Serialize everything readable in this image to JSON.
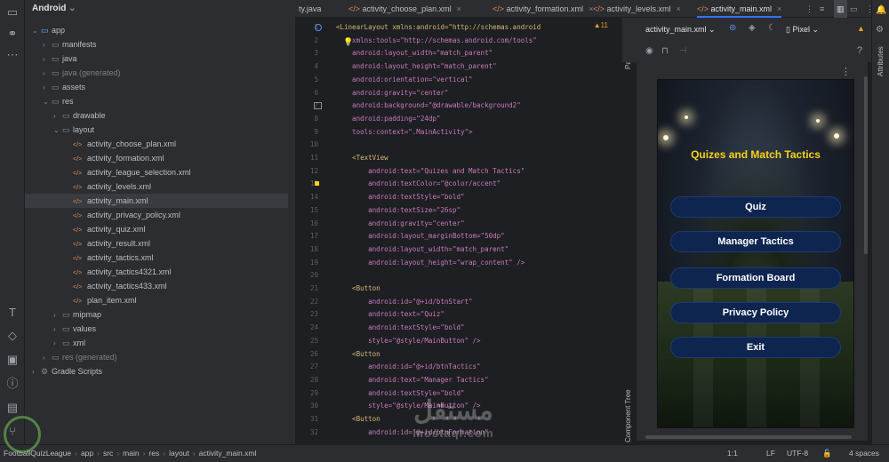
{
  "project": {
    "view_title": "Android",
    "tree": [
      {
        "label": "app",
        "depth": 0,
        "kind": "module",
        "open": true
      },
      {
        "label": "manifests",
        "depth": 1,
        "kind": "folder"
      },
      {
        "label": "java",
        "depth": 1,
        "kind": "folder"
      },
      {
        "label": "java (generated)",
        "depth": 1,
        "kind": "folder",
        "muted": true
      },
      {
        "label": "assets",
        "depth": 1,
        "kind": "folder"
      },
      {
        "label": "res",
        "depth": 1,
        "kind": "folder",
        "open": true
      },
      {
        "label": "drawable",
        "depth": 2,
        "kind": "folder"
      },
      {
        "label": "layout",
        "depth": 2,
        "kind": "folder",
        "open": true
      },
      {
        "label": "activity_choose_plan.xml",
        "depth": 3,
        "kind": "file"
      },
      {
        "label": "activity_formation.xml",
        "depth": 3,
        "kind": "file"
      },
      {
        "label": "activity_league_selection.xml",
        "depth": 3,
        "kind": "file"
      },
      {
        "label": "activity_levels.xml",
        "depth": 3,
        "kind": "file"
      },
      {
        "label": "activity_main.xml",
        "depth": 3,
        "kind": "file",
        "selected": true
      },
      {
        "label": "activity_privacy_policy.xml",
        "depth": 3,
        "kind": "file"
      },
      {
        "label": "activity_quiz.xml",
        "depth": 3,
        "kind": "file"
      },
      {
        "label": "activity_result.xml",
        "depth": 3,
        "kind": "file"
      },
      {
        "label": "activity_tactics.xml",
        "depth": 3,
        "kind": "file"
      },
      {
        "label": "activity_tactics4321.xml",
        "depth": 3,
        "kind": "file"
      },
      {
        "label": "activity_tactics433.xml",
        "depth": 3,
        "kind": "file"
      },
      {
        "label": "plan_item.xml",
        "depth": 3,
        "kind": "file"
      },
      {
        "label": "mipmap",
        "depth": 2,
        "kind": "folder"
      },
      {
        "label": "values",
        "depth": 2,
        "kind": "folder"
      },
      {
        "label": "xml",
        "depth": 2,
        "kind": "folder"
      },
      {
        "label": "res (generated)",
        "depth": 1,
        "kind": "folder",
        "muted": true
      },
      {
        "label": "Gradle Scripts",
        "depth": 0,
        "kind": "gradle"
      }
    ]
  },
  "tabs": [
    {
      "label": "ty.java"
    },
    {
      "label": "activity_choose_plan.xml"
    },
    {
      "label": "activity_formation.xml"
    },
    {
      "label": "activity_levels.xml"
    },
    {
      "label": "activity_main.xml",
      "active": true
    }
  ],
  "editor": {
    "warnings": "▲11",
    "lines": [
      {
        "n": "1",
        "text": "<LinearLayout xmlns:android=\"http://schemas.android"
      },
      {
        "n": "2",
        "text": "    xmlns:tools=\"http://schemas.android.com/tools\""
      },
      {
        "n": "3",
        "text": "    android:layout_width=\"match_parent\""
      },
      {
        "n": "4",
        "text": "    android:layout_height=\"match_parent\""
      },
      {
        "n": "5",
        "text": "    android:orientation=\"vertical\""
      },
      {
        "n": "6",
        "text": "    android:gravity=\"center\""
      },
      {
        "n": "7",
        "text": "    android:background=\"@drawable/background2\""
      },
      {
        "n": "8",
        "text": "    android:padding=\"24dp\""
      },
      {
        "n": "9",
        "text": "    tools:context=\".MainActivity\">"
      },
      {
        "n": "10",
        "text": ""
      },
      {
        "n": "11",
        "text": "    <TextView"
      },
      {
        "n": "12",
        "text": "        android:text=\"Quizes and Match Tactics\""
      },
      {
        "n": "13",
        "text": "        android:textColor=\"@color/accent\""
      },
      {
        "n": "14",
        "text": "        android:textStyle=\"bold\""
      },
      {
        "n": "15",
        "text": "        android:textSize=\"26sp\""
      },
      {
        "n": "16",
        "text": "        android:gravity=\"center\""
      },
      {
        "n": "17",
        "text": "        android:layout_marginBottom=\"50dp\""
      },
      {
        "n": "18",
        "text": "        android:layout_width=\"match_parent\""
      },
      {
        "n": "19",
        "text": "        android:layout_height=\"wrap_content\" />"
      },
      {
        "n": "20",
        "text": ""
      },
      {
        "n": "21",
        "text": "    <Button"
      },
      {
        "n": "22",
        "text": "        android:id=\"@+id/btnStart\""
      },
      {
        "n": "23",
        "text": "        android:text=\"Quiz\""
      },
      {
        "n": "24",
        "text": "        android:textStyle=\"bold\""
      },
      {
        "n": "25",
        "text": "        style=\"@style/MainButton\" />"
      },
      {
        "n": "26",
        "text": "    <Button"
      },
      {
        "n": "27",
        "text": "        android:id=\"@+id/btnTactics\""
      },
      {
        "n": "28",
        "text": "        android:text=\"Manager Tactics\""
      },
      {
        "n": "29",
        "text": "        android:textStyle=\"bold\""
      },
      {
        "n": "30",
        "text": "        style=\"@style/MainButton\" />"
      },
      {
        "n": "31",
        "text": "    <Button"
      },
      {
        "n": "32",
        "text": "        android:id=\"@+id/btnFormation\""
      }
    ]
  },
  "design": {
    "file_select": "activity_main.xml",
    "device_select": "Pixel",
    "palette_label": "Palette",
    "component_tree_label": "Component Tree",
    "attributes_label": "Attributes",
    "help": "?",
    "more": "⋮"
  },
  "phone": {
    "title": "Quizes and Match Tactics",
    "title_color": "#f5d21a",
    "buttons": [
      "Quiz",
      "Manager Tactics",
      "Formation Board",
      "Privacy Policy",
      "Exit"
    ]
  },
  "statusbar": {
    "breadcrumbs": [
      "FootballQuizLeague",
      "app",
      "src",
      "main",
      "res",
      "layout",
      "activity_main.xml"
    ],
    "position": "1:1",
    "line_sep": "LF",
    "encoding": "UTF-8",
    "indent": "4 spaces"
  },
  "watermark": {
    "arabic": "مستقل",
    "latin": "mostaql.com"
  },
  "colors": {
    "accent": "#3574f0",
    "button_bg": "#0e2550"
  }
}
